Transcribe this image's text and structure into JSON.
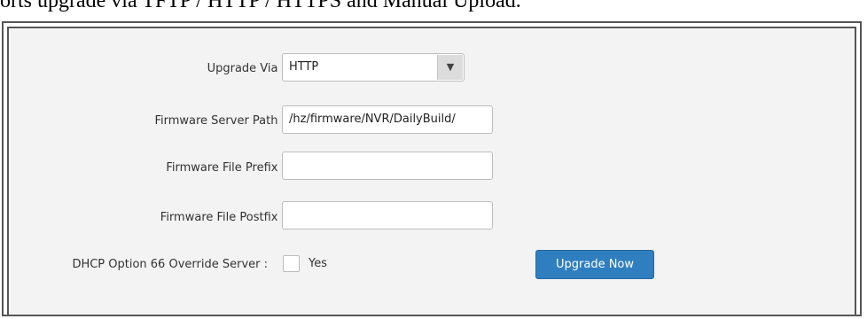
{
  "caption": "orts upgrade via TFTP / HTTP / HTTPS and Manual Upload.",
  "form": {
    "upgrade_via": {
      "label": "Upgrade Via :",
      "value": "HTTP"
    },
    "server_path": {
      "label": "Firmware Server Path :",
      "value": "/hz/firmware/NVR/DailyBuild/"
    },
    "file_prefix": {
      "label": "Firmware File Prefix :",
      "value": ""
    },
    "file_postfix": {
      "label": "Firmware File Postfix :",
      "value": ""
    },
    "dhcp_override": {
      "label": "DHCP Option 66 Override Server :",
      "checkbox_label": "Yes",
      "checked": false
    }
  },
  "upgrade_button": {
    "label": "Upgrade Now",
    "color": "#2f7fc0"
  }
}
